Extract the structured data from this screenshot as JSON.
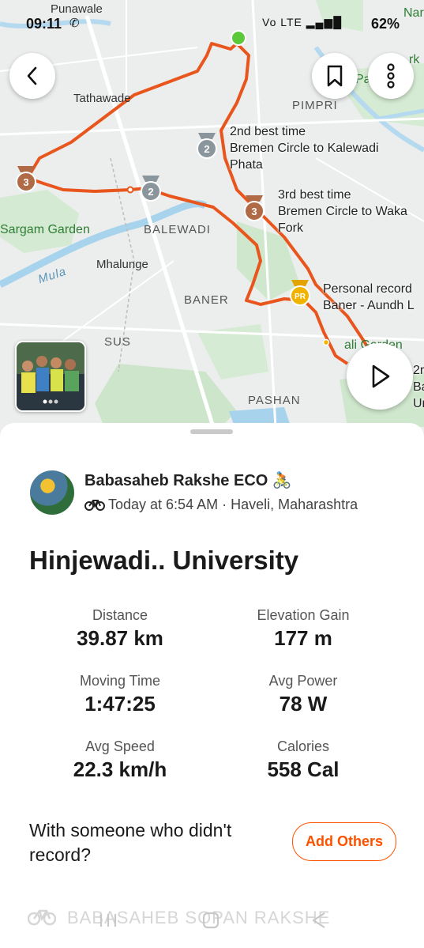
{
  "status_bar": {
    "time": "09:11",
    "signal_text": "Vo LTE",
    "battery": "62%"
  },
  "map": {
    "place_labels": {
      "punawale": "Punawale",
      "tathawade": "Tathawade",
      "pimpri": "PIMPRI",
      "sargam": "Sargam Garden",
      "balewadi": "BALEWADI",
      "mula": "Mula",
      "mhalunge": "Mhalunge",
      "baner": "BANER",
      "sus": "SUS",
      "pashan": "PASHAN",
      "nar": "Nar",
      "rk": "rk",
      "pa": "Pa",
      "garden_right": "ali Garden"
    },
    "segments": [
      {
        "line1": "2nd best time",
        "line2": "Bremen Circle to Kalewadi",
        "line3": "Phata",
        "rank": "2"
      },
      {
        "line1": "3rd best time",
        "line2": "Bremen Circle to Waka",
        "line3": "Fork",
        "rank": "3"
      },
      {
        "line1": "Personal record",
        "line2": "Baner - Aundh L",
        "line3": "",
        "rank": "PR"
      },
      {
        "line1": "2r",
        "line2": "Ba",
        "line3": "Ur",
        "rank": ""
      }
    ],
    "medal_left": "3",
    "medal_mid": "2",
    "route_color": "#e8561d",
    "start_color": "#5cc93a"
  },
  "buttons": {
    "back": "back",
    "bookmark": "bookmark",
    "more": "more",
    "play": "play"
  },
  "activity": {
    "athlete_name": "Babasaheb Rakshe ECO 🚴",
    "meta": "Today at 6:54 AM · Haveli, Maharashtra",
    "title": "Hinjewadi.. University"
  },
  "stats": [
    {
      "label": "Distance",
      "value": "39.87 km"
    },
    {
      "label": "Elevation Gain",
      "value": "177 m"
    },
    {
      "label": "Moving Time",
      "value": "1:47:25"
    },
    {
      "label": "Avg Power",
      "value": "78 W"
    },
    {
      "label": "Avg Speed",
      "value": "22.3 km/h"
    },
    {
      "label": "Calories",
      "value": "558 Cal"
    }
  ],
  "others": {
    "prompt": "With someone who didn't record?",
    "button": "Add Others"
  },
  "footer": {
    "text": "BABASAHEB SOPAN RAKSHE"
  },
  "colors": {
    "accent": "#fc5200"
  }
}
